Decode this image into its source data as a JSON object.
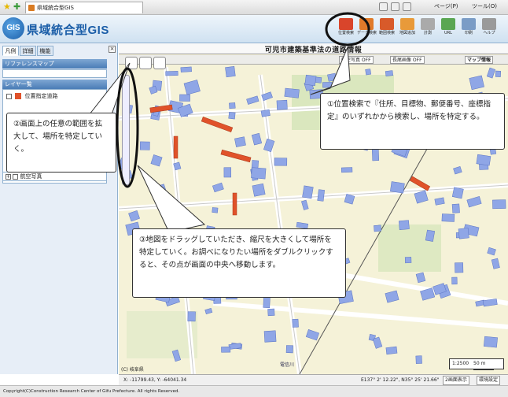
{
  "browser": {
    "tab_title": "県域統合型GIS",
    "page_label": "ページ(P)",
    "tools_label": "ツール(O)"
  },
  "app": {
    "logo_text": "GIS",
    "title": "県域統合型GIS",
    "toolbar": [
      {
        "label": "位置検索",
        "icon": "location-search-icon",
        "color": "#d9452b"
      },
      {
        "label": "データ検索",
        "icon": "data-search-icon",
        "color": "#e07a2a"
      },
      {
        "label": "範囲検索",
        "icon": "area-search-icon",
        "color": "#d85a2a"
      },
      {
        "label": "地図追加",
        "icon": "map-add-icon",
        "color": "#e89a3a"
      },
      {
        "label": "計測",
        "icon": "measure-icon",
        "color": "#aaaaaa"
      },
      {
        "label": "URL",
        "icon": "url-icon",
        "color": "#5aa653"
      },
      {
        "label": "印刷",
        "icon": "print-icon",
        "color": "#7a9cc6"
      },
      {
        "label": "ヘルプ",
        "icon": "help-icon",
        "color": "#9a9a9a"
      }
    ]
  },
  "left_panel": {
    "tabs": [
      "凡例",
      "詳細",
      "機能"
    ],
    "reference_map_label": "リファレンスマップ",
    "layer_list_label": "レイヤ一覧",
    "layer_item": "位置指定道路",
    "aerial_label": "航空写真"
  },
  "map": {
    "title": "可児市建築基準法の道路情報",
    "layer_buttons": [
      "航空写真 OFF",
      "長尾画像 OFF"
    ],
    "map_info_label": "マップ情報",
    "copyright": "(C) 岐阜県",
    "scale_label": "1:2500",
    "scale_bar": "50 m",
    "place_label": "電信川"
  },
  "callouts": {
    "c1": "①位置検索で『住所、目標物、郵便番号、座標指定』のいずれかから検索し、場所を特定する。",
    "c2": "②画面上の任意の範囲を拡大して、場所を特定していく。",
    "c3": "③地図をドラッグしていただき、縮尺を大きくして場所を特定していく。お調べになりたい場所をダブルクリックすると、その点が画面の中央へ移動します。"
  },
  "status": {
    "xy": "X: -11799.43, Y: -64041.34",
    "latlon": "E137° 2' 12.22\", N35° 25' 21.66\"",
    "overview_label": "2画面表示",
    "settings_label": "環境設定"
  },
  "footer": {
    "copyright": "Copyright(C)Construction Research Center of Gifu Prefecture. All rights Reserved."
  },
  "colors": {
    "accent": "#1b5ea8",
    "building": "#8fa6e6",
    "road_highlight": "#e0522a",
    "park": "#cfe3b4",
    "ground": "#f5f2d8"
  }
}
